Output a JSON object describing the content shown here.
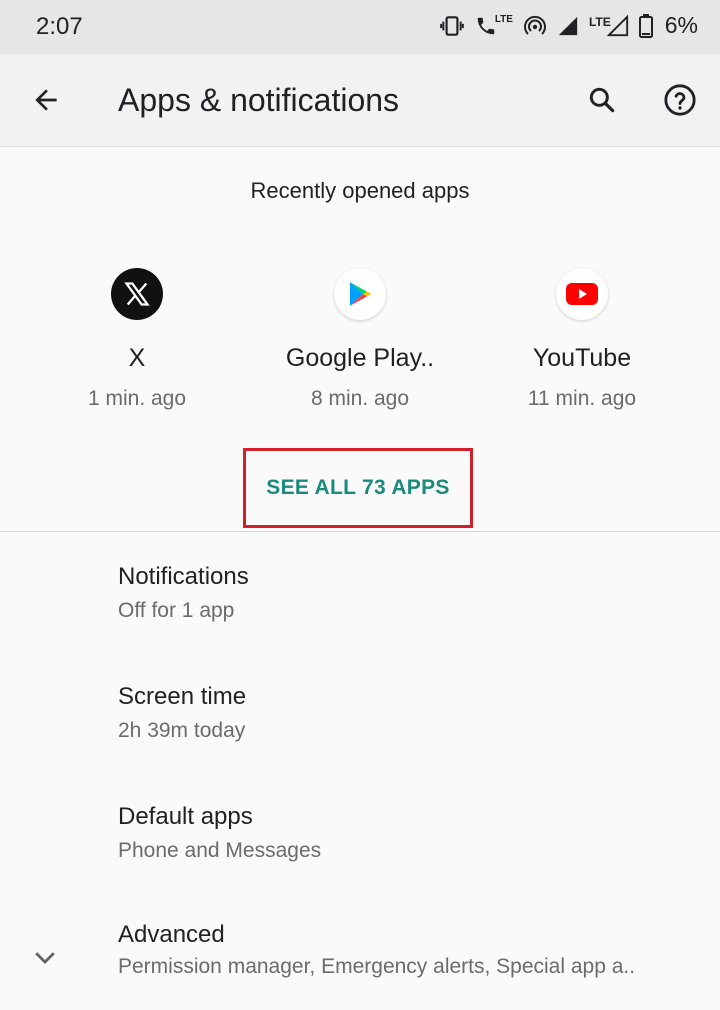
{
  "status_bar": {
    "time": "2:07",
    "lte_label": "LTE",
    "battery": "6%"
  },
  "app_bar": {
    "title": "Apps & notifications",
    "icons": [
      "back-arrow-icon",
      "search-icon",
      "help-icon"
    ]
  },
  "recent": {
    "header": "Recently opened apps",
    "apps": [
      {
        "name": "X",
        "time": "1 min. ago",
        "icon": "x-logo-icon"
      },
      {
        "name": "Google Play..",
        "time": "8 min. ago",
        "icon": "google-play-icon"
      },
      {
        "name": "YouTube",
        "time": "11 min. ago",
        "icon": "youtube-icon"
      }
    ],
    "see_all": "SEE ALL 73 APPS"
  },
  "settings": [
    {
      "title": "Notifications",
      "summary": "Off for 1 app"
    },
    {
      "title": "Screen time",
      "summary": "2h 39m today"
    },
    {
      "title": "Default apps",
      "summary": "Phone and Messages"
    },
    {
      "title": "Advanced",
      "summary": "Permission manager, Emergency alerts, Special app a..",
      "icon": "chevron-down-icon"
    }
  ],
  "colors": {
    "accent": "#1a8a7d",
    "highlight_border": "#d0202a",
    "youtube_red": "#ff0000",
    "app_bar_bg": "#f2f2f2",
    "status_bar_bg": "#e6e6e6"
  }
}
